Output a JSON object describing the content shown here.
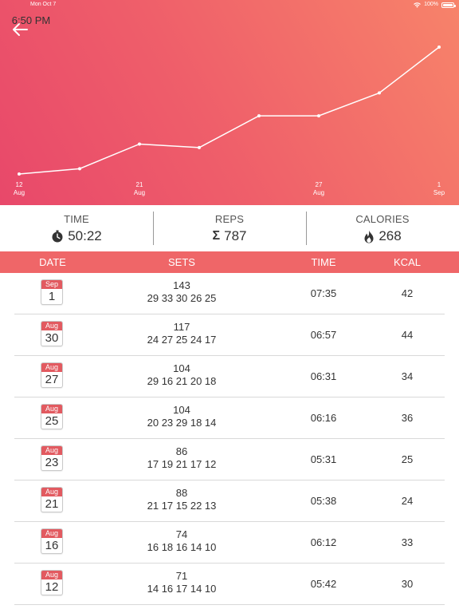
{
  "status_bar": {
    "time": "6:50 PM",
    "date": "Mon Oct 7",
    "battery": "100%"
  },
  "chart_data": {
    "type": "line",
    "x": [
      "12 Aug",
      "16 Aug",
      "21 Aug",
      "23 Aug",
      "25 Aug",
      "27 Aug",
      "30 Aug",
      "1 Sep"
    ],
    "values": [
      71,
      74,
      88,
      86,
      104,
      104,
      117,
      143
    ],
    "tick_labels": [
      {
        "day": "12",
        "month": "Aug",
        "index": 0
      },
      {
        "day": "21",
        "month": "Aug",
        "index": 2
      },
      {
        "day": "27",
        "month": "Aug",
        "index": 5
      },
      {
        "day": "1",
        "month": "Sep",
        "index": 7
      }
    ],
    "title": "",
    "xlabel": "",
    "ylabel": "",
    "grid": false,
    "color": "#ffffff"
  },
  "summary": {
    "time_label": "TIME",
    "time_value": "50:22",
    "reps_label": "REPS",
    "reps_value": "787",
    "calories_label": "CALORIES",
    "calories_value": "268"
  },
  "table": {
    "headers": {
      "date": "DATE",
      "sets": "SETS",
      "time": "TIME",
      "kcal": "KCAL"
    },
    "rows": [
      {
        "month": "Sep",
        "day": "1",
        "total": "143",
        "sets": "29 33 30 26 25",
        "time": "07:35",
        "kcal": "42"
      },
      {
        "month": "Aug",
        "day": "30",
        "total": "117",
        "sets": "24 27 25 24 17",
        "time": "06:57",
        "kcal": "44"
      },
      {
        "month": "Aug",
        "day": "27",
        "total": "104",
        "sets": "29 16 21 20 18",
        "time": "06:31",
        "kcal": "34"
      },
      {
        "month": "Aug",
        "day": "25",
        "total": "104",
        "sets": "20 23 29 18 14",
        "time": "06:16",
        "kcal": "36"
      },
      {
        "month": "Aug",
        "day": "23",
        "total": "86",
        "sets": "17 19 21 17 12",
        "time": "05:31",
        "kcal": "25"
      },
      {
        "month": "Aug",
        "day": "21",
        "total": "88",
        "sets": "21 17 15 22 13",
        "time": "05:38",
        "kcal": "24"
      },
      {
        "month": "Aug",
        "day": "16",
        "total": "74",
        "sets": "16 18 16 14 10",
        "time": "06:12",
        "kcal": "33"
      },
      {
        "month": "Aug",
        "day": "12",
        "total": "71",
        "sets": "14 16 17 14 10",
        "time": "05:42",
        "kcal": "30"
      }
    ]
  },
  "colors": {
    "header_start": "#e8486a",
    "header_end": "#f7836a",
    "table_header": "#ef6668",
    "calendar_month": "#e25a60"
  },
  "icons": {
    "back": "arrow-left-icon",
    "time": "stopwatch-icon",
    "reps": "sigma-icon",
    "calories": "flame-icon"
  }
}
